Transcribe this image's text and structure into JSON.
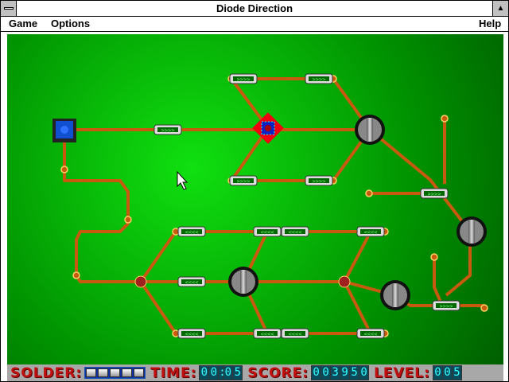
{
  "window": {
    "title": "Diode Direction"
  },
  "menu": {
    "game": "Game",
    "options": "Options",
    "help": "Help"
  },
  "status": {
    "solder_label": "SOLDER:",
    "solder_units": 5,
    "time_label": "TIME:",
    "time": [
      "0",
      "0",
      ":",
      "0",
      "5"
    ],
    "score_label": "SCORE:",
    "score": [
      "0",
      "0",
      "3",
      "9",
      "5",
      "0"
    ],
    "level_label": "LEVEL:",
    "level": [
      "0",
      "0",
      "5"
    ]
  },
  "colors": {
    "board": "#00a000",
    "wire": "#c85a10",
    "status_bg": "#a8a8a8",
    "label": "#c01010",
    "digit": "#33ffff"
  }
}
